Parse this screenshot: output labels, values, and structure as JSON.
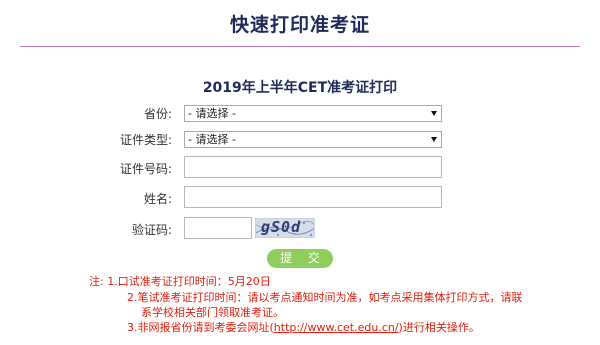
{
  "header": {
    "title": "快速打印准考证"
  },
  "form": {
    "title": "2019年上半年CET准考证打印",
    "province_label": "省份:",
    "province_value": "- 请选择 -",
    "id_type_label": "证件类型:",
    "id_type_value": "- 请选择 -",
    "id_number_label": "证件号码:",
    "name_label": "姓名:",
    "captcha_label": "验证码:",
    "captcha_text": "gS0d",
    "submit_label": "提 交"
  },
  "notes": {
    "line1": "注: 1.口试准考证打印时间：5月20日",
    "line2": "2.笔试准考证打印时间：请以考点通知时间为准，如考点采用集体打印方式，请联",
    "line3": "系学校相关部门领取准考证。",
    "line4_prefix": "3.非网报省份请到考委会网址(",
    "line4_link": "http://www.cet.edu.cn/",
    "line4_suffix": ")进行相关操作。"
  },
  "colors": {
    "title": "#1f2a5a",
    "rule": "#c57bc3",
    "button": "#8fce5d",
    "notes": "#e0200f"
  }
}
